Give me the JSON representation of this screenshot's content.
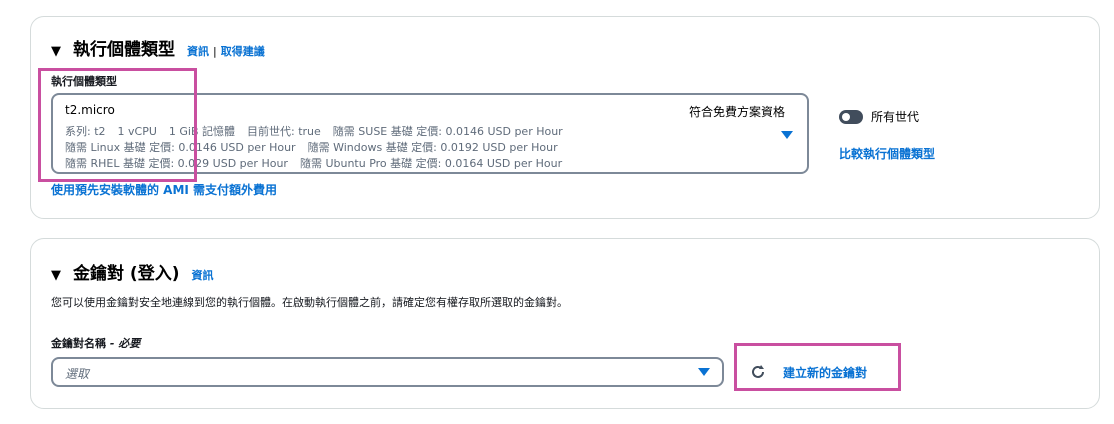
{
  "instance_type": {
    "title": "執行個體類型",
    "info_link": "資訊",
    "divider": "|",
    "advice_link": "取得建議",
    "field_label": "執行個體類型",
    "selected": {
      "name": "t2.micro",
      "free_tier": "符合免費方案資格",
      "line1": [
        "系列: t2",
        "1 vCPU",
        "1 GiB 記憶體",
        "目前世代: true",
        "隨需 SUSE 基礎 定價: 0.0146 USD per Hour"
      ],
      "line2": [
        "隨需 Linux 基礎 定價: 0.0146 USD per Hour",
        "隨需 Windows 基礎 定價: 0.0192 USD per Hour"
      ],
      "line3": [
        "隨需 RHEL 基礎 定價: 0.029 USD per Hour",
        "隨需 Ubuntu Pro 基礎 定價: 0.0164 USD per Hour"
      ]
    },
    "all_generations_label": "所有世代",
    "compare_link": "比較執行個體類型",
    "ami_note": "使用預先安裝軟體的 AMI 需支付額外費用"
  },
  "key_pair": {
    "title": "金鑰對 (登入)",
    "info_link": "資訊",
    "description": "您可以使用金鑰對安全地連線到您的執行個體。在啟動執行個體之前，請確定您有權存取所選取的金鑰對。",
    "field_label": "金鑰對名稱",
    "required_suffix": "- 必要",
    "placeholder": "選取",
    "create_new": "建立新的金鑰對"
  }
}
